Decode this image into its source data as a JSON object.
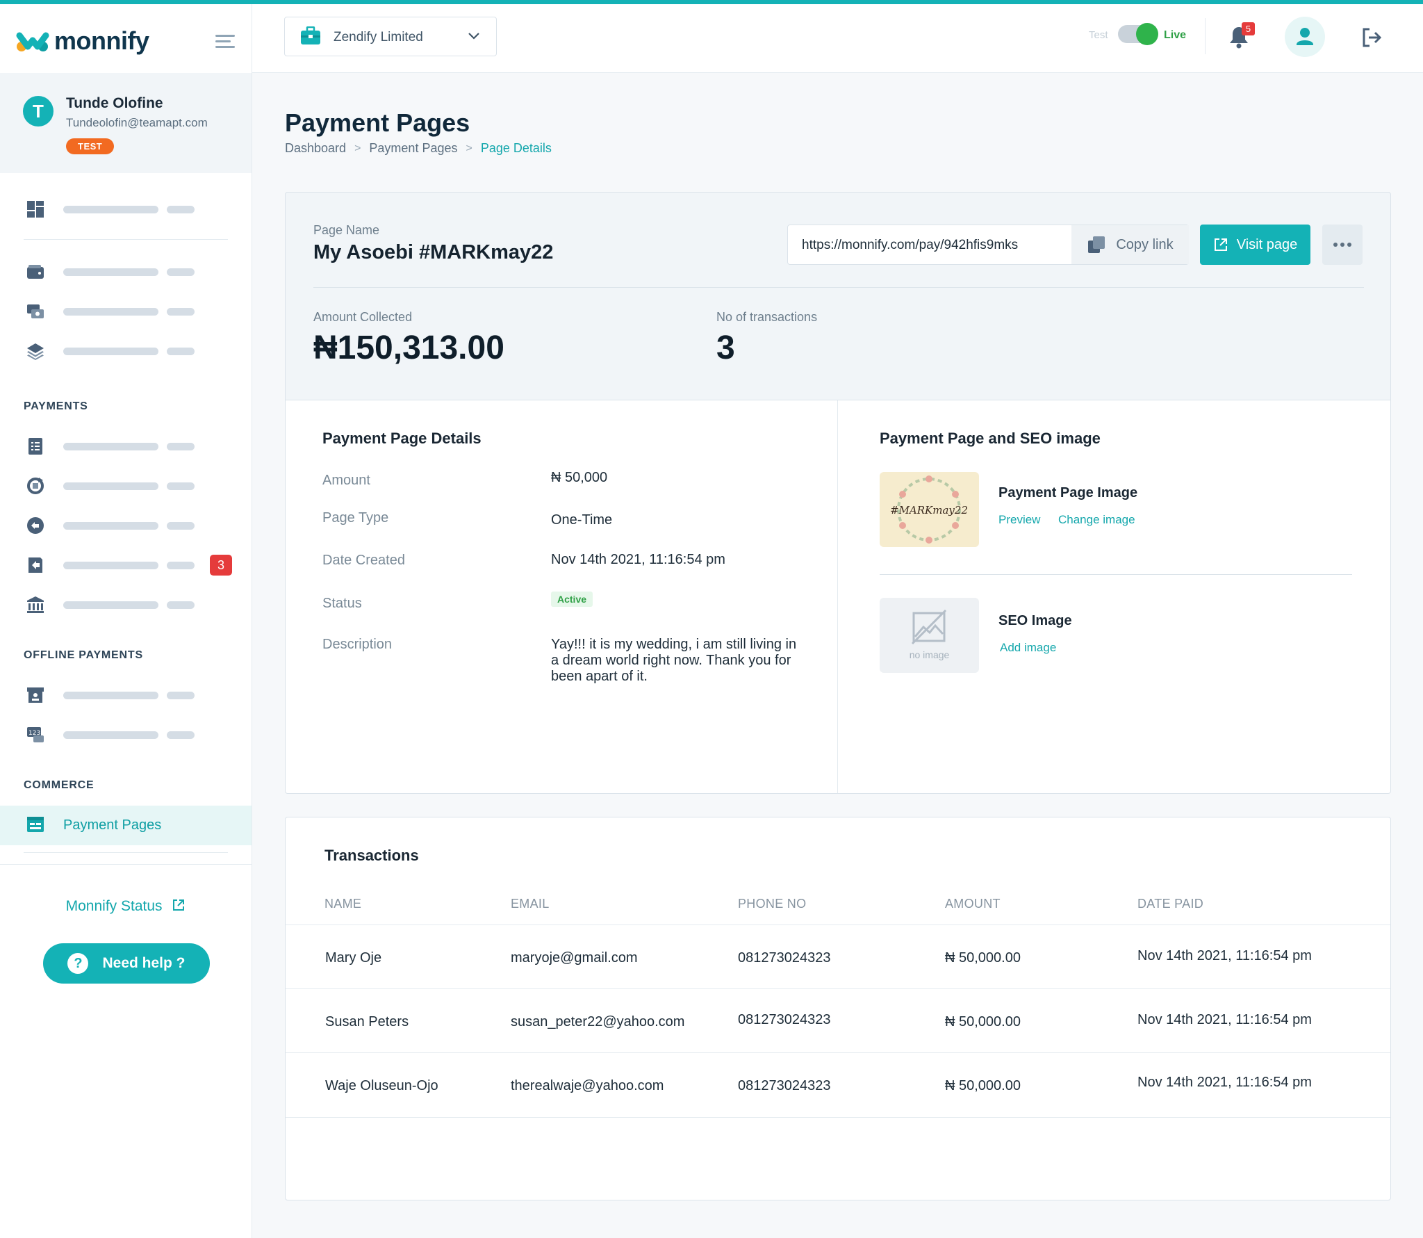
{
  "app": {
    "brand": "monnify",
    "accent_color": "#14b2b6",
    "danger_color": "#e53b3b"
  },
  "user": {
    "initial": "T",
    "name": "Tunde Olofine",
    "email": "Tundeolofin@teamapt.com",
    "env_badge": "TEST"
  },
  "sidebar": {
    "sections": {
      "payments": "PAYMENTS",
      "offline": "OFFLINE PAYMENTS",
      "commerce": "COMMERCE"
    },
    "dispute_count": "3",
    "active_item": "Payment Pages",
    "status_link": "Monnify Status",
    "help_button": "Need help ?"
  },
  "header": {
    "business_name": "Zendify Limited",
    "toggle_test": "Test",
    "toggle_live": "Live",
    "notification_count": "5"
  },
  "page": {
    "title": "Payment Pages",
    "breadcrumb": [
      "Dashboard",
      "Payment Pages",
      "Page Details"
    ]
  },
  "summary": {
    "page_name_label": "Page Name",
    "page_name": "My Asoebi #MARKmay22",
    "link": "https://monnify.com/pay/942hfis9mks",
    "copy_label": "Copy link",
    "visit_label": "Visit page",
    "amount_label": "Amount Collected",
    "amount": "₦150,313.00",
    "tx_label": "No of transactions",
    "tx_count": "3"
  },
  "details": {
    "heading": "Payment Page Details",
    "amount_label": "Amount",
    "amount": "₦ 50,000",
    "type_label": "Page Type",
    "type": "One-Time",
    "date_label": "Date Created",
    "date": "Nov 14th 2021, 11:16:54 pm",
    "status_label": "Status",
    "status": "Active",
    "description_label": "Description",
    "description": "Yay!!! it is my wedding, i am still living in a dream world right now. Thank you for been apart of it."
  },
  "images": {
    "heading": "Payment Page and SEO image",
    "page_image_title": "Payment Page Image",
    "page_image_text": "#MARKmay22",
    "preview": "Preview",
    "change": "Change image",
    "seo_title": "SEO Image",
    "seo_placeholder": "no image",
    "add": "Add image"
  },
  "transactions": {
    "title": "Transactions",
    "columns": [
      "NAME",
      "EMAIL",
      "PHONE NO",
      "AMOUNT",
      "DATE PAID"
    ],
    "rows": [
      {
        "name": "Mary Oje",
        "email": "maryoje@gmail.com",
        "phone": "081273024323",
        "amount": "₦ 50,000.00",
        "date": "Nov 14th 2021, 11:16:54 pm"
      },
      {
        "name": "Susan Peters",
        "email": "susan_peter22@yahoo.com",
        "phone": "081273024323",
        "amount": "₦ 50,000.00",
        "date": "Nov 14th 2021, 11:16:54 pm"
      },
      {
        "name": "Waje Oluseun-Ojo",
        "email": "therealwaje@yahoo.com",
        "phone": "081273024323",
        "amount": "₦ 50,000.00",
        "date": "Nov 14th 2021, 11:16:54 pm"
      }
    ]
  }
}
